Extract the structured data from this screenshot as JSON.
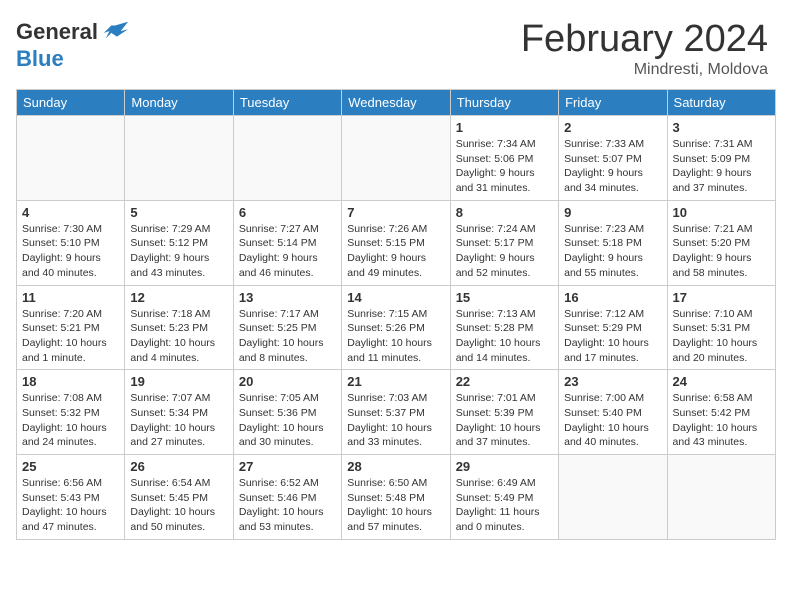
{
  "header": {
    "logo_general": "General",
    "logo_blue": "Blue",
    "month_title": "February 2024",
    "location": "Mindresti, Moldova"
  },
  "days_of_week": [
    "Sunday",
    "Monday",
    "Tuesday",
    "Wednesday",
    "Thursday",
    "Friday",
    "Saturday"
  ],
  "weeks": [
    [
      {
        "day": "",
        "info": ""
      },
      {
        "day": "",
        "info": ""
      },
      {
        "day": "",
        "info": ""
      },
      {
        "day": "",
        "info": ""
      },
      {
        "day": "1",
        "info": "Sunrise: 7:34 AM\nSunset: 5:06 PM\nDaylight: 9 hours and 31 minutes."
      },
      {
        "day": "2",
        "info": "Sunrise: 7:33 AM\nSunset: 5:07 PM\nDaylight: 9 hours and 34 minutes."
      },
      {
        "day": "3",
        "info": "Sunrise: 7:31 AM\nSunset: 5:09 PM\nDaylight: 9 hours and 37 minutes."
      }
    ],
    [
      {
        "day": "4",
        "info": "Sunrise: 7:30 AM\nSunset: 5:10 PM\nDaylight: 9 hours and 40 minutes."
      },
      {
        "day": "5",
        "info": "Sunrise: 7:29 AM\nSunset: 5:12 PM\nDaylight: 9 hours and 43 minutes."
      },
      {
        "day": "6",
        "info": "Sunrise: 7:27 AM\nSunset: 5:14 PM\nDaylight: 9 hours and 46 minutes."
      },
      {
        "day": "7",
        "info": "Sunrise: 7:26 AM\nSunset: 5:15 PM\nDaylight: 9 hours and 49 minutes."
      },
      {
        "day": "8",
        "info": "Sunrise: 7:24 AM\nSunset: 5:17 PM\nDaylight: 9 hours and 52 minutes."
      },
      {
        "day": "9",
        "info": "Sunrise: 7:23 AM\nSunset: 5:18 PM\nDaylight: 9 hours and 55 minutes."
      },
      {
        "day": "10",
        "info": "Sunrise: 7:21 AM\nSunset: 5:20 PM\nDaylight: 9 hours and 58 minutes."
      }
    ],
    [
      {
        "day": "11",
        "info": "Sunrise: 7:20 AM\nSunset: 5:21 PM\nDaylight: 10 hours and 1 minute."
      },
      {
        "day": "12",
        "info": "Sunrise: 7:18 AM\nSunset: 5:23 PM\nDaylight: 10 hours and 4 minutes."
      },
      {
        "day": "13",
        "info": "Sunrise: 7:17 AM\nSunset: 5:25 PM\nDaylight: 10 hours and 8 minutes."
      },
      {
        "day": "14",
        "info": "Sunrise: 7:15 AM\nSunset: 5:26 PM\nDaylight: 10 hours and 11 minutes."
      },
      {
        "day": "15",
        "info": "Sunrise: 7:13 AM\nSunset: 5:28 PM\nDaylight: 10 hours and 14 minutes."
      },
      {
        "day": "16",
        "info": "Sunrise: 7:12 AM\nSunset: 5:29 PM\nDaylight: 10 hours and 17 minutes."
      },
      {
        "day": "17",
        "info": "Sunrise: 7:10 AM\nSunset: 5:31 PM\nDaylight: 10 hours and 20 minutes."
      }
    ],
    [
      {
        "day": "18",
        "info": "Sunrise: 7:08 AM\nSunset: 5:32 PM\nDaylight: 10 hours and 24 minutes."
      },
      {
        "day": "19",
        "info": "Sunrise: 7:07 AM\nSunset: 5:34 PM\nDaylight: 10 hours and 27 minutes."
      },
      {
        "day": "20",
        "info": "Sunrise: 7:05 AM\nSunset: 5:36 PM\nDaylight: 10 hours and 30 minutes."
      },
      {
        "day": "21",
        "info": "Sunrise: 7:03 AM\nSunset: 5:37 PM\nDaylight: 10 hours and 33 minutes."
      },
      {
        "day": "22",
        "info": "Sunrise: 7:01 AM\nSunset: 5:39 PM\nDaylight: 10 hours and 37 minutes."
      },
      {
        "day": "23",
        "info": "Sunrise: 7:00 AM\nSunset: 5:40 PM\nDaylight: 10 hours and 40 minutes."
      },
      {
        "day": "24",
        "info": "Sunrise: 6:58 AM\nSunset: 5:42 PM\nDaylight: 10 hours and 43 minutes."
      }
    ],
    [
      {
        "day": "25",
        "info": "Sunrise: 6:56 AM\nSunset: 5:43 PM\nDaylight: 10 hours and 47 minutes."
      },
      {
        "day": "26",
        "info": "Sunrise: 6:54 AM\nSunset: 5:45 PM\nDaylight: 10 hours and 50 minutes."
      },
      {
        "day": "27",
        "info": "Sunrise: 6:52 AM\nSunset: 5:46 PM\nDaylight: 10 hours and 53 minutes."
      },
      {
        "day": "28",
        "info": "Sunrise: 6:50 AM\nSunset: 5:48 PM\nDaylight: 10 hours and 57 minutes."
      },
      {
        "day": "29",
        "info": "Sunrise: 6:49 AM\nSunset: 5:49 PM\nDaylight: 11 hours and 0 minutes."
      },
      {
        "day": "",
        "info": ""
      },
      {
        "day": "",
        "info": ""
      }
    ]
  ]
}
